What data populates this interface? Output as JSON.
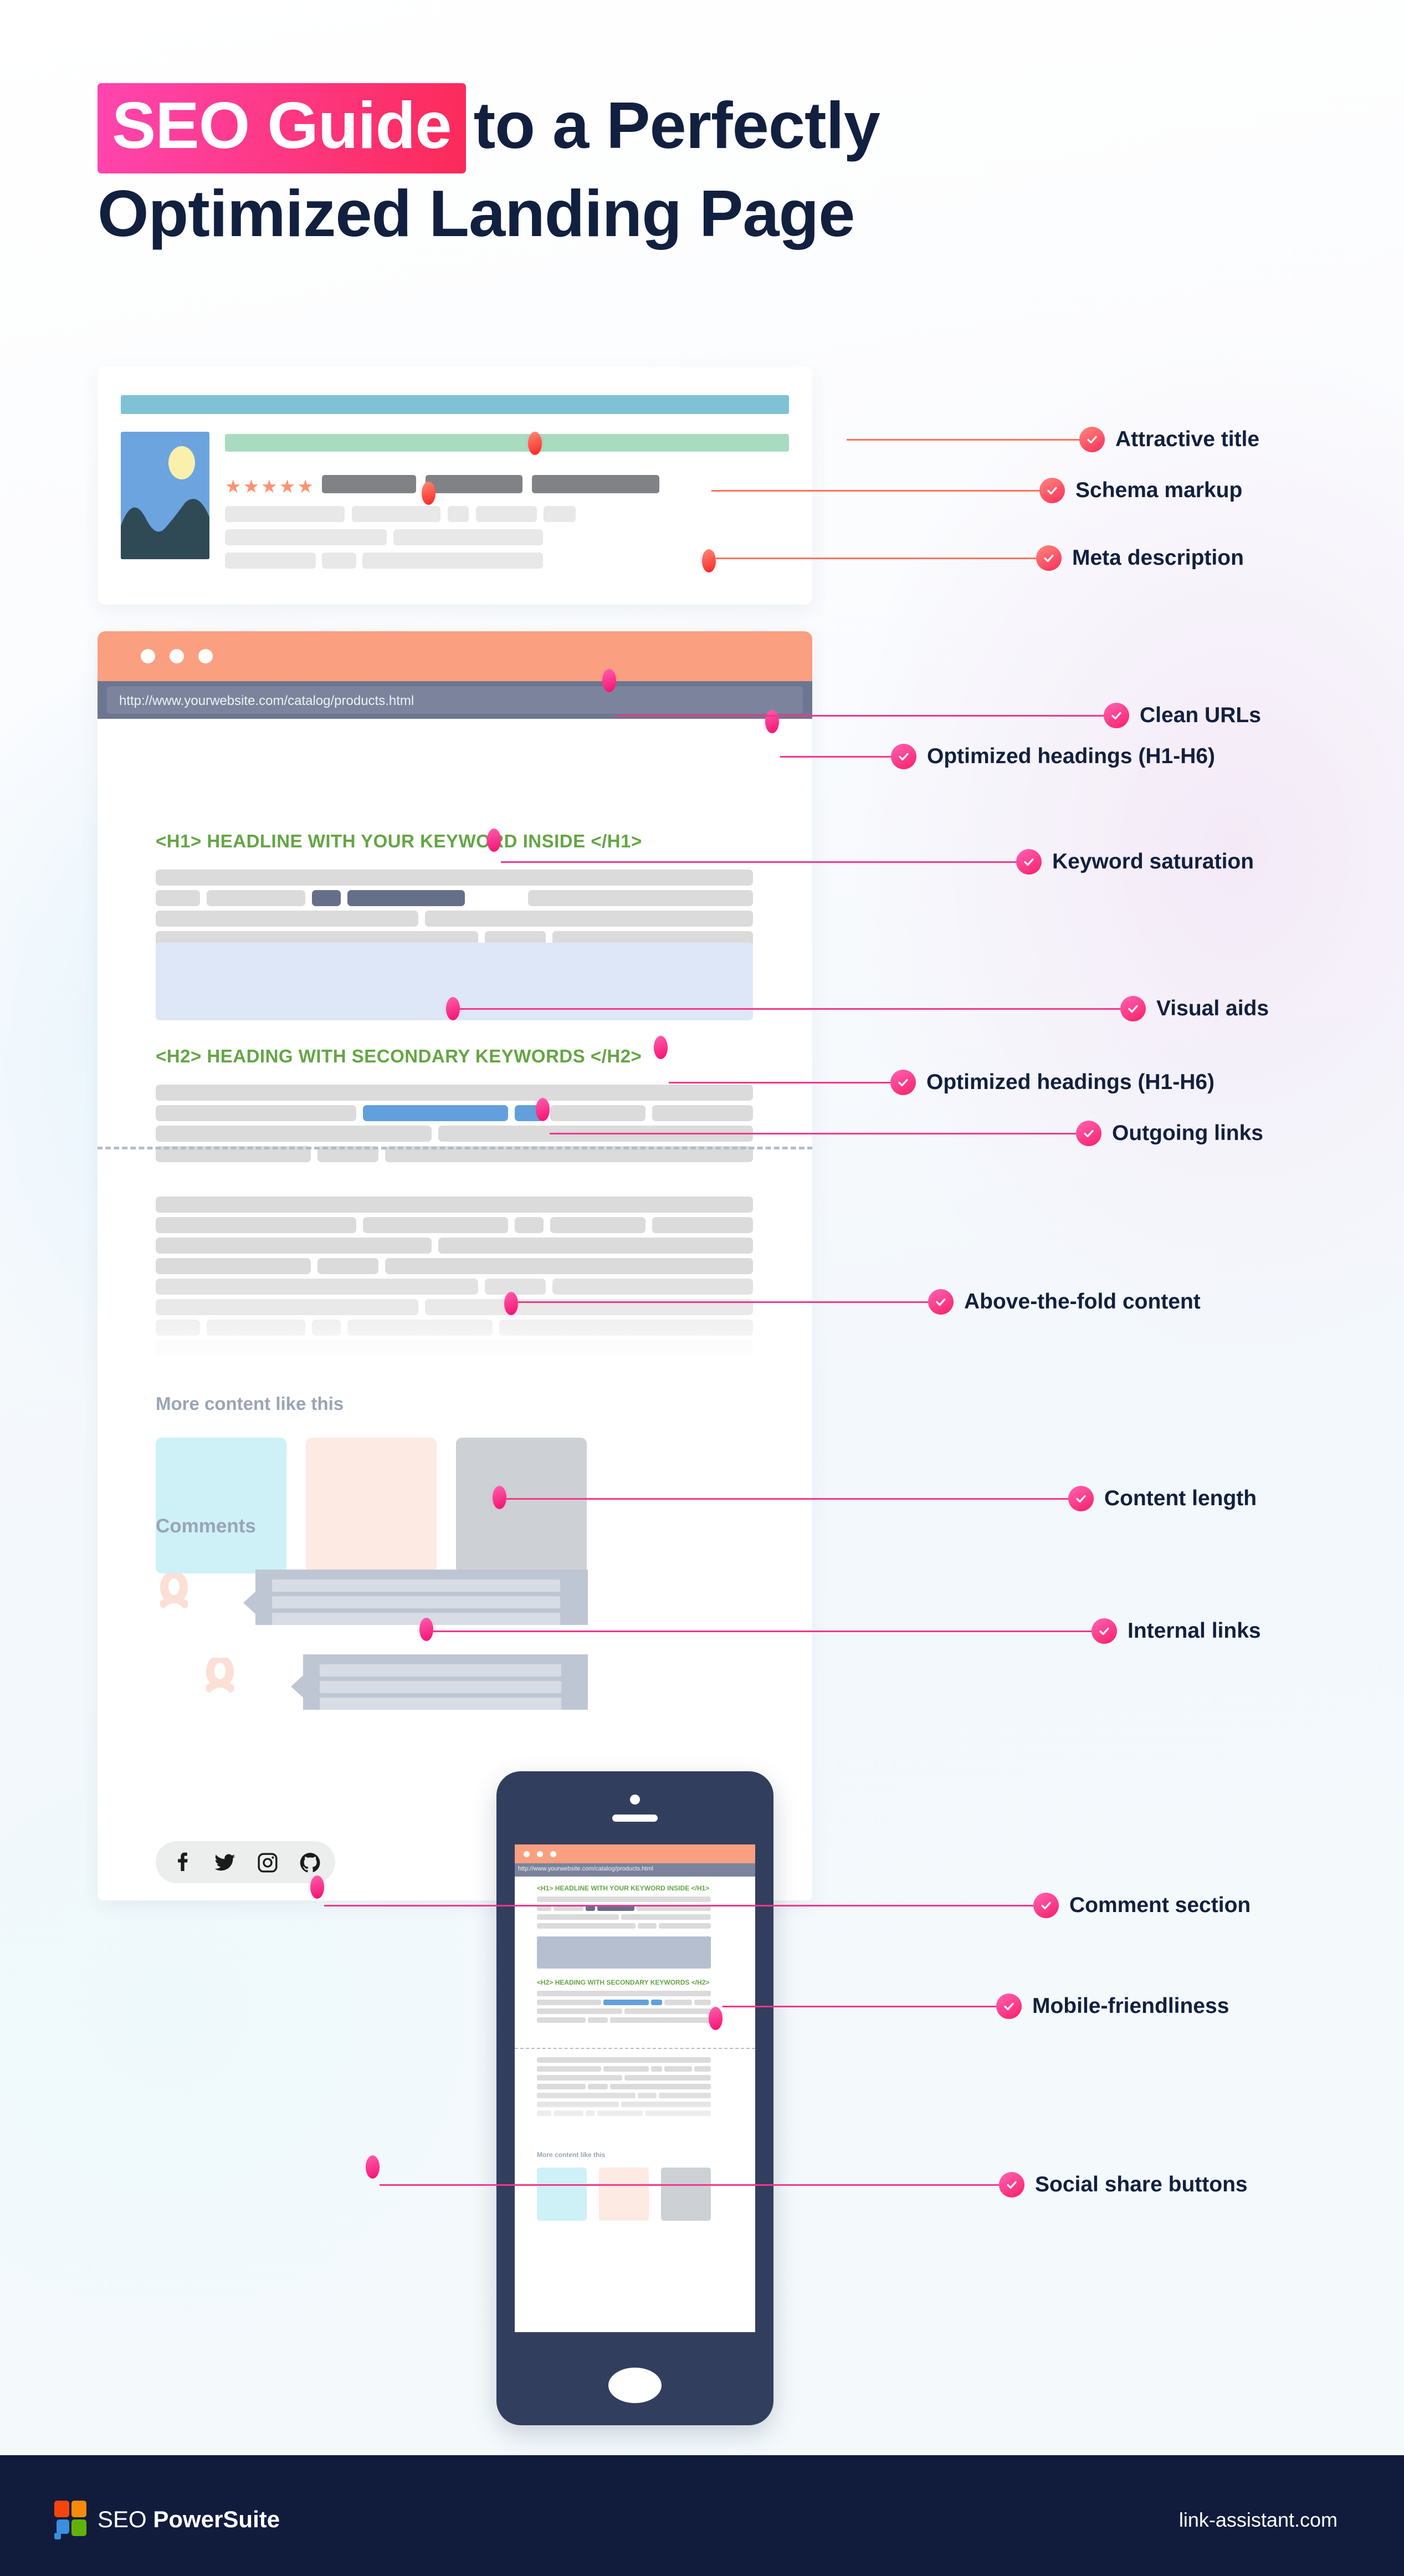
{
  "title": {
    "highlight": "SEO Guide",
    "rest_line1": "to a Perfectly",
    "line2": "Optimized Landing Page"
  },
  "serp": {
    "stars": "★★★★★",
    "star_count": 5
  },
  "browser": {
    "url": "http://www.yourwebsite.com/catalog/products.html",
    "h1": "<H1> HEADLINE WITH YOUR KEYWORD INSIDE </H1>",
    "h2": "<H2> HEADING WITH SECONDARY KEYWORDS </H2>",
    "more_content": "More content like this",
    "comments": "Comments",
    "social": [
      "facebook-icon",
      "twitter-icon",
      "instagram-icon",
      "github-icon"
    ]
  },
  "phone": {
    "url": "http://www.yourwebsite.com/catalog/products.html",
    "h1": "<H1> HEADLINE WITH YOUR KEYWORD INSIDE </H1>",
    "h2": "<H2>  HEADING WITH SECONDARY KEYWORDS </H2>",
    "more_content": "More content like this"
  },
  "callouts": [
    {
      "label": "Attractive title",
      "tone": "salmon"
    },
    {
      "label": "Schema markup",
      "tone": "salmon"
    },
    {
      "label": "Meta description",
      "tone": "salmon"
    },
    {
      "label": "Clean URLs",
      "tone": "pink"
    },
    {
      "label": "Optimized headings (H1-H6)",
      "tone": "pink"
    },
    {
      "label": "Keyword saturation",
      "tone": "pink"
    },
    {
      "label": "Visual aids",
      "tone": "pink"
    },
    {
      "label": "Optimized headings (H1-H6)",
      "tone": "pink"
    },
    {
      "label": "Outgoing links",
      "tone": "pink"
    },
    {
      "label": "Above-the-fold content",
      "tone": "pink"
    },
    {
      "label": "Content length",
      "tone": "pink"
    },
    {
      "label": "Internal links",
      "tone": "pink"
    },
    {
      "label": "Comment section",
      "tone": "pink"
    },
    {
      "label": "Mobile-friendliness",
      "tone": "pink"
    },
    {
      "label": "Social share buttons",
      "tone": "pink"
    }
  ],
  "footer": {
    "brand_light": "SEO ",
    "brand_bold": "PowerSuite",
    "url": "link-assistant.com"
  },
  "colors": {
    "accent_pink": "#f3368b",
    "accent_salmon": "#fb7361",
    "navy": "#12203f",
    "heading_green": "#65a545",
    "link_blue": "#62a0dd",
    "keyword_gray": "#656f8a",
    "chrome_peach": "#fb9f81",
    "footer_navy": "#111c3d"
  }
}
